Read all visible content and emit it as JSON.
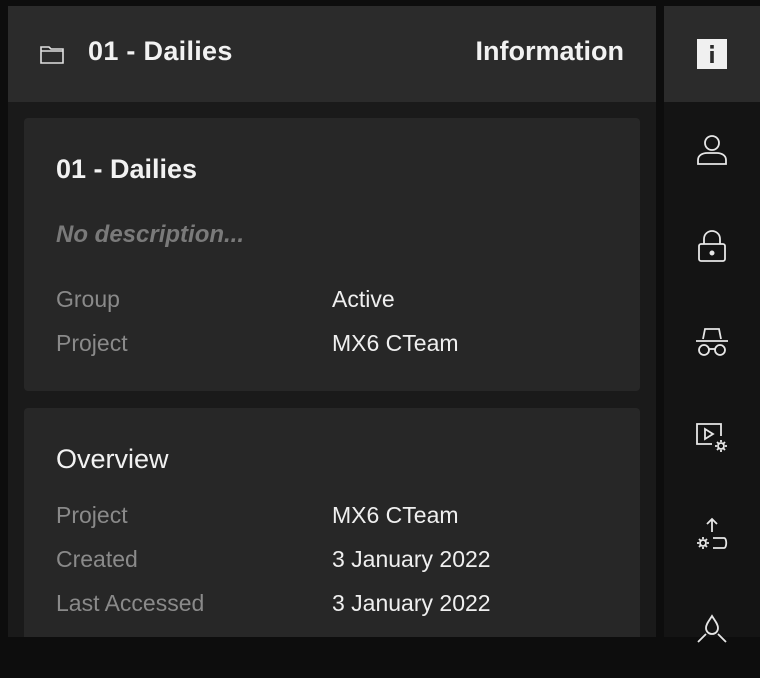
{
  "header": {
    "title": "01 - Dailies",
    "panel_title": "Information",
    "folder_icon": "folder-icon"
  },
  "info_card": {
    "title": "01 - Dailies",
    "description": "No description...",
    "rows": [
      {
        "label": "Group",
        "value": "Active"
      },
      {
        "label": "Project",
        "value": "MX6 CTeam"
      }
    ]
  },
  "overview_card": {
    "title": "Overview",
    "rows": [
      {
        "label": "Project",
        "value": "MX6 CTeam"
      },
      {
        "label": "Created",
        "value": "3 January 2022"
      },
      {
        "label": "Last Accessed",
        "value": "3 January 2022"
      }
    ]
  },
  "sidebar": {
    "items": [
      {
        "icon": "info-icon",
        "active": true
      },
      {
        "icon": "user-icon",
        "active": false
      },
      {
        "icon": "lock-icon",
        "active": false
      },
      {
        "icon": "incognito-icon",
        "active": false
      },
      {
        "icon": "video-settings-icon",
        "active": false
      },
      {
        "icon": "upload-settings-icon",
        "active": false
      },
      {
        "icon": "droplet-icon",
        "active": false
      }
    ]
  },
  "colors": {
    "accent_bg": "#2b2b2b",
    "card_bg": "#272727",
    "muted_text": "#8a8a8a"
  }
}
